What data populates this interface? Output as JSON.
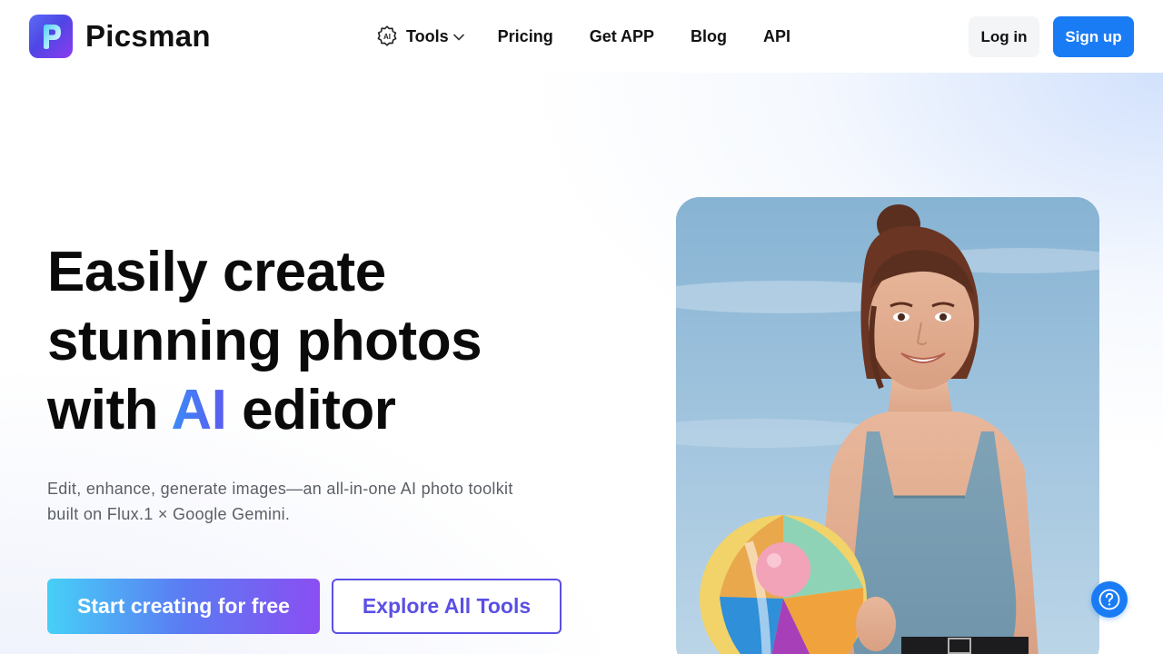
{
  "brand": {
    "name": "Picsman",
    "logo_letter": "P"
  },
  "nav": {
    "tools": {
      "label": "Tools",
      "icon": "ai-sparkle-icon",
      "badge": "AI"
    },
    "items": [
      {
        "label": "Pricing"
      },
      {
        "label": "Get APP"
      },
      {
        "label": "Blog"
      },
      {
        "label": "API"
      }
    ]
  },
  "auth": {
    "login_label": "Log in",
    "signup_label": "Sign up"
  },
  "hero": {
    "headline_line1": "Easily create",
    "headline_line2": "stunning photos",
    "headline_line3_pre": "with ",
    "headline_line3_ai": "AI",
    "headline_line3_post": " editor",
    "subtitle_line1": "Edit, enhance, generate images—an all-in-one AI photo toolkit",
    "subtitle_line2": "built on Flux.1 × Google Gemini.",
    "primary_cta": "Start creating for free",
    "secondary_cta": "Explore All Tools"
  },
  "help": {
    "icon": "question-icon"
  },
  "colors": {
    "accent_blue": "#1a7cf5",
    "accent_purple": "#5b4fe6",
    "cta_gradient_start": "#46d0f7",
    "cta_gradient_end": "#8a4ef2"
  }
}
